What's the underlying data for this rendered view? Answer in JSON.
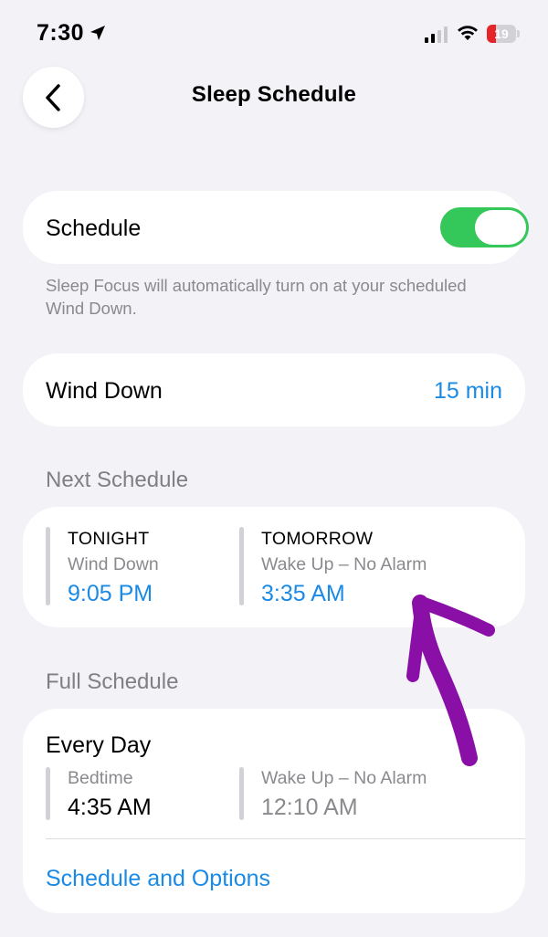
{
  "status_bar": {
    "time": "7:30",
    "battery_level": "19",
    "battery_fraction": 0.19,
    "icons": [
      "location-arrow-icon",
      "cellular-signal-icon",
      "wifi-icon",
      "battery-icon"
    ]
  },
  "header": {
    "back_icon": "chevron-left-icon",
    "title": "Sleep Schedule"
  },
  "schedule": {
    "label": "Schedule",
    "toggle_on": true,
    "footnote": "Sleep Focus will automatically turn on at your scheduled Wind Down."
  },
  "wind_down": {
    "label": "Wind Down",
    "value": "15 min"
  },
  "next_schedule": {
    "header": "Next Schedule",
    "columns": [
      {
        "day": "TONIGHT",
        "event": "Wind Down",
        "time": "9:05 PM"
      },
      {
        "day": "TOMORROW",
        "event": "Wake Up – No Alarm",
        "time": "3:35 AM"
      }
    ]
  },
  "full_schedule": {
    "header": "Full Schedule",
    "title": "Every Day",
    "columns": [
      {
        "event": "Bedtime",
        "time": "4:35 AM"
      },
      {
        "event": "Wake Up – No Alarm",
        "time": "12:10 AM"
      }
    ],
    "options_link": "Schedule and Options"
  },
  "colors": {
    "accent_blue": "#1a8ae5",
    "toggle_green": "#34c759",
    "annotation_purple": "#8a0fa6",
    "battery_red": "#e5252a"
  }
}
